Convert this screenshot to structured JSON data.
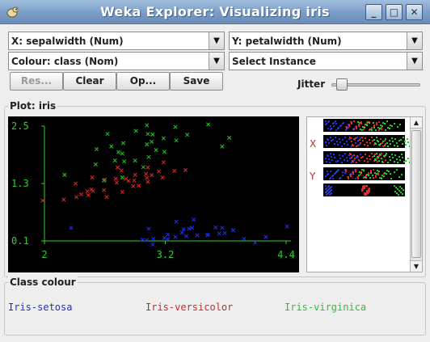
{
  "window": {
    "title": "Weka Explorer: Visualizing iris",
    "minimize_glyph": "_",
    "maximize_glyph": "□",
    "close_glyph": "✕",
    "icon": "weka-bird-icon"
  },
  "controls": {
    "x_axis": "X: sepalwidth (Num)",
    "y_axis": "Y: petalwidth (Num)",
    "colour": "Colour: class (Nom)",
    "select_instance": "Select Instance",
    "buttons": {
      "reset": "Res...",
      "clear": "Clear",
      "open": "Op...",
      "save": "Save"
    },
    "jitter_label": "Jitter",
    "jitter_value": 0.05
  },
  "plot": {
    "group_title": "Plot: iris",
    "side_x_label": "X",
    "side_y_label": "Y"
  },
  "class_colour": {
    "group_title": "Class colour",
    "classes": [
      {
        "label": "Iris-setosa",
        "color": "#1f2cd8"
      },
      {
        "label": "Iris-versicolor",
        "color": "#c42c2c"
      },
      {
        "label": "Iris-virginica",
        "color": "#2fc22f"
      }
    ]
  },
  "chart_data": {
    "type": "scatter",
    "xlabel": "",
    "ylabel": "",
    "x_ticks": [
      "2",
      "3.2",
      "4.4"
    ],
    "y_ticks": [
      "2.5",
      "1.3",
      "0.1"
    ],
    "xlim": [
      2,
      4.4
    ],
    "ylim": [
      0.1,
      2.5
    ],
    "marker": "x",
    "series": [
      {
        "name": "Iris-setosa",
        "color": "#2233ee",
        "x": [
          2.3,
          3.0,
          3.1,
          3.2,
          3.3,
          3.4,
          3.5,
          3.6,
          3.7,
          3.8,
          3.9,
          4.0,
          4.1,
          4.2,
          4.4,
          3.0,
          3.2,
          3.4,
          3.5,
          3.1,
          3.4,
          3.8,
          3.7,
          3.3,
          3.6,
          3.2,
          3.0,
          3.4,
          3.9,
          3.5
        ],
        "y": [
          0.3,
          0.2,
          0.2,
          0.2,
          0.2,
          0.2,
          0.2,
          0.2,
          0.2,
          0.3,
          0.4,
          0.2,
          0.1,
          0.2,
          0.4,
          0.1,
          0.1,
          0.3,
          0.3,
          0.1,
          0.4,
          0.3,
          0.4,
          0.5,
          0.2,
          0.2,
          0.3,
          0.2,
          0.4,
          0.6
        ]
      },
      {
        "name": "Iris-versicolor",
        "color": "#dd2a2a",
        "x": [
          2.0,
          2.2,
          2.2,
          2.3,
          2.3,
          2.4,
          2.4,
          2.5,
          2.5,
          2.5,
          2.6,
          2.6,
          2.7,
          2.7,
          2.7,
          2.8,
          2.8,
          2.8,
          2.9,
          2.9,
          2.9,
          3.0,
          3.0,
          3.0,
          3.1,
          3.1,
          3.2,
          3.2,
          3.3,
          3.4,
          2.8,
          2.6,
          3.0,
          2.9,
          2.4
        ],
        "y": [
          1.0,
          1.0,
          1.5,
          1.3,
          1.0,
          1.1,
          1.0,
          1.1,
          1.5,
          1.2,
          1.2,
          1.4,
          1.4,
          1.3,
          1.6,
          1.3,
          1.5,
          1.2,
          1.3,
          1.4,
          1.5,
          1.5,
          1.4,
          1.6,
          1.5,
          1.4,
          1.5,
          1.8,
          1.6,
          1.6,
          1.4,
          1.0,
          1.3,
          1.2,
          1.0
        ]
      },
      {
        "name": "Iris-virginica",
        "color": "#22cc22",
        "x": [
          2.2,
          2.5,
          2.5,
          2.6,
          2.7,
          2.7,
          2.8,
          2.8,
          2.8,
          2.9,
          2.9,
          3.0,
          3.0,
          3.0,
          3.1,
          3.1,
          3.2,
          3.2,
          3.3,
          3.3,
          3.4,
          3.6,
          3.8,
          3.8,
          2.8,
          3.0,
          2.6,
          2.7,
          3.1,
          3.0
        ],
        "y": [
          1.5,
          1.7,
          2.0,
          2.3,
          1.9,
          2.0,
          2.0,
          2.2,
          1.8,
          1.8,
          2.4,
          2.1,
          2.3,
          1.8,
          2.1,
          2.4,
          2.3,
          2.0,
          2.5,
          2.2,
          2.3,
          2.5,
          2.2,
          2.0,
          1.5,
          1.7,
          1.4,
          1.8,
          2.0,
          2.5
        ]
      }
    ]
  }
}
